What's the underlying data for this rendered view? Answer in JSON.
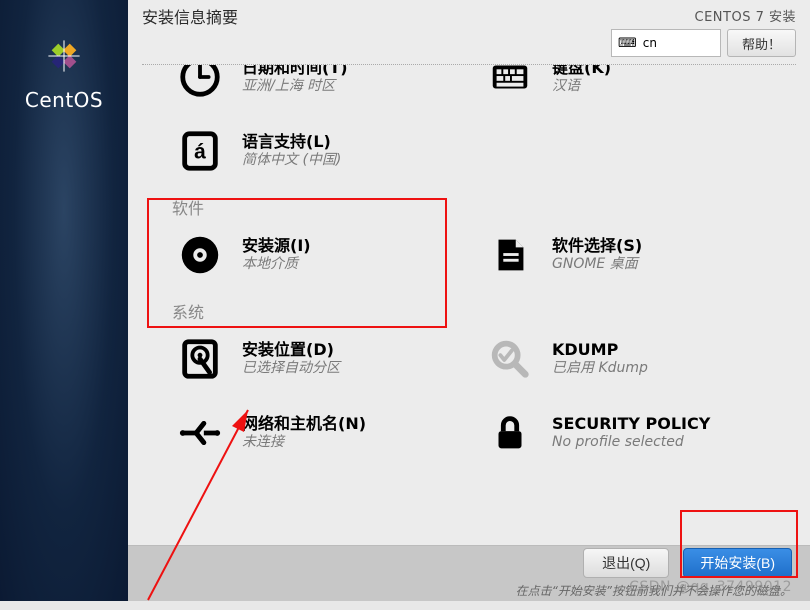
{
  "brand": "CentOS",
  "header": {
    "title": "安装信息摘要",
    "installer_name": "CENTOS 7 安装",
    "language_code": "cn",
    "help_label": "帮助！"
  },
  "localization": {
    "datetime": {
      "title": "日期和时间(T)",
      "sub": "亚洲/上海 时区"
    },
    "keyboard": {
      "title": "键盘(K)",
      "sub": "汉语"
    },
    "language": {
      "title": "语言支持(L)",
      "sub": "简体中文 (中国)"
    }
  },
  "software": {
    "section_label": "软件",
    "source": {
      "title": "安装源(I)",
      "sub": "本地介质"
    },
    "selection": {
      "title": "软件选择(S)",
      "sub": "GNOME 桌面"
    }
  },
  "system": {
    "section_label": "系统",
    "destination": {
      "title": "安装位置(D)",
      "sub": "已选择自动分区"
    },
    "kdump": {
      "title": "KDUMP",
      "sub": "已启用 Kdump"
    },
    "network": {
      "title": "网络和主机名(N)",
      "sub": "未连接"
    },
    "security": {
      "title": "SECURITY POLICY",
      "sub": "No profile selected"
    }
  },
  "footer": {
    "quit": "退出(Q)",
    "begin": "开始安装(B)",
    "hint": "在点击“开始安装”按钮前我们并不会操作您的磁盘。"
  },
  "watermark": "CSDN @qq_37499012"
}
